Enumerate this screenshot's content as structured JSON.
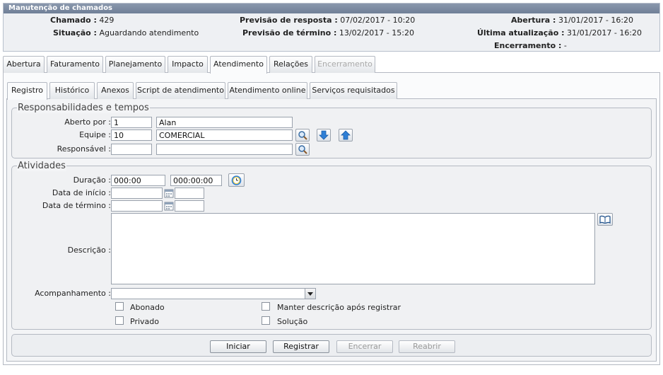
{
  "window": {
    "title": "Manutenção de chamados"
  },
  "header": {
    "chamado_label": "Chamado :",
    "chamado_value": "429",
    "situacao_label": "Situação :",
    "situacao_value": "Aguardando atendimento",
    "prev_resposta_label": "Previsão de resposta :",
    "prev_resposta_value": "07/02/2017 - 10:20",
    "prev_termino_label": "Previsão de término :",
    "prev_termino_value": "13/02/2017 - 15:20",
    "abertura_label": "Abertura :",
    "abertura_value": "31/01/2017 - 16:20",
    "ultima_label": "Última atualização :",
    "ultima_value": "31/01/2017 - 16:20",
    "encerramento_label": "Encerramento :",
    "encerramento_value": "-"
  },
  "main_tabs": [
    {
      "label": "Abertura"
    },
    {
      "label": "Faturamento"
    },
    {
      "label": "Planejamento"
    },
    {
      "label": "Impacto"
    },
    {
      "label": "Atendimento"
    },
    {
      "label": "Relações"
    },
    {
      "label": "Encerramento"
    }
  ],
  "sub_tabs": [
    {
      "label": "Registro"
    },
    {
      "label": "Histórico"
    },
    {
      "label": "Anexos"
    },
    {
      "label": "Script de atendimento"
    },
    {
      "label": "Atendimento online"
    },
    {
      "label": "Serviços requisitados"
    }
  ],
  "responsabilidades": {
    "legend": "Responsabilidades e tempos",
    "aberto_por_label": "Aberto por :",
    "aberto_por_code": "1",
    "aberto_por_name": "Alan",
    "equipe_label": "Equipe :",
    "equipe_code": "10",
    "equipe_name": "COMERCIAL",
    "responsavel_label": "Responsável :",
    "responsavel_code": "",
    "responsavel_name": ""
  },
  "atividades": {
    "legend": "Atividades",
    "duracao_label": "Duração :",
    "duracao_value1": "000:00",
    "duracao_value2": "000:00:00",
    "inicio_label": "Data de início :",
    "inicio_date": "",
    "inicio_time": "",
    "termino_label": "Data de término :",
    "termino_date": "",
    "termino_time": "",
    "descricao_label": "Descrição :",
    "descricao_value": "",
    "acompanhamento_label": "Acompanhamento :",
    "acompanhamento_value": "",
    "abonado_label": "Abonado",
    "privado_label": "Privado",
    "manter_label": "Manter descrição após registrar",
    "solucao_label": "Solução"
  },
  "buttons": {
    "iniciar": "Iniciar",
    "registrar": "Registrar",
    "encerrar": "Encerrar",
    "reabrir": "Reabrir"
  },
  "colors": {
    "title_bar": "#7a899f",
    "accent_blue": "#2f7fd6"
  }
}
